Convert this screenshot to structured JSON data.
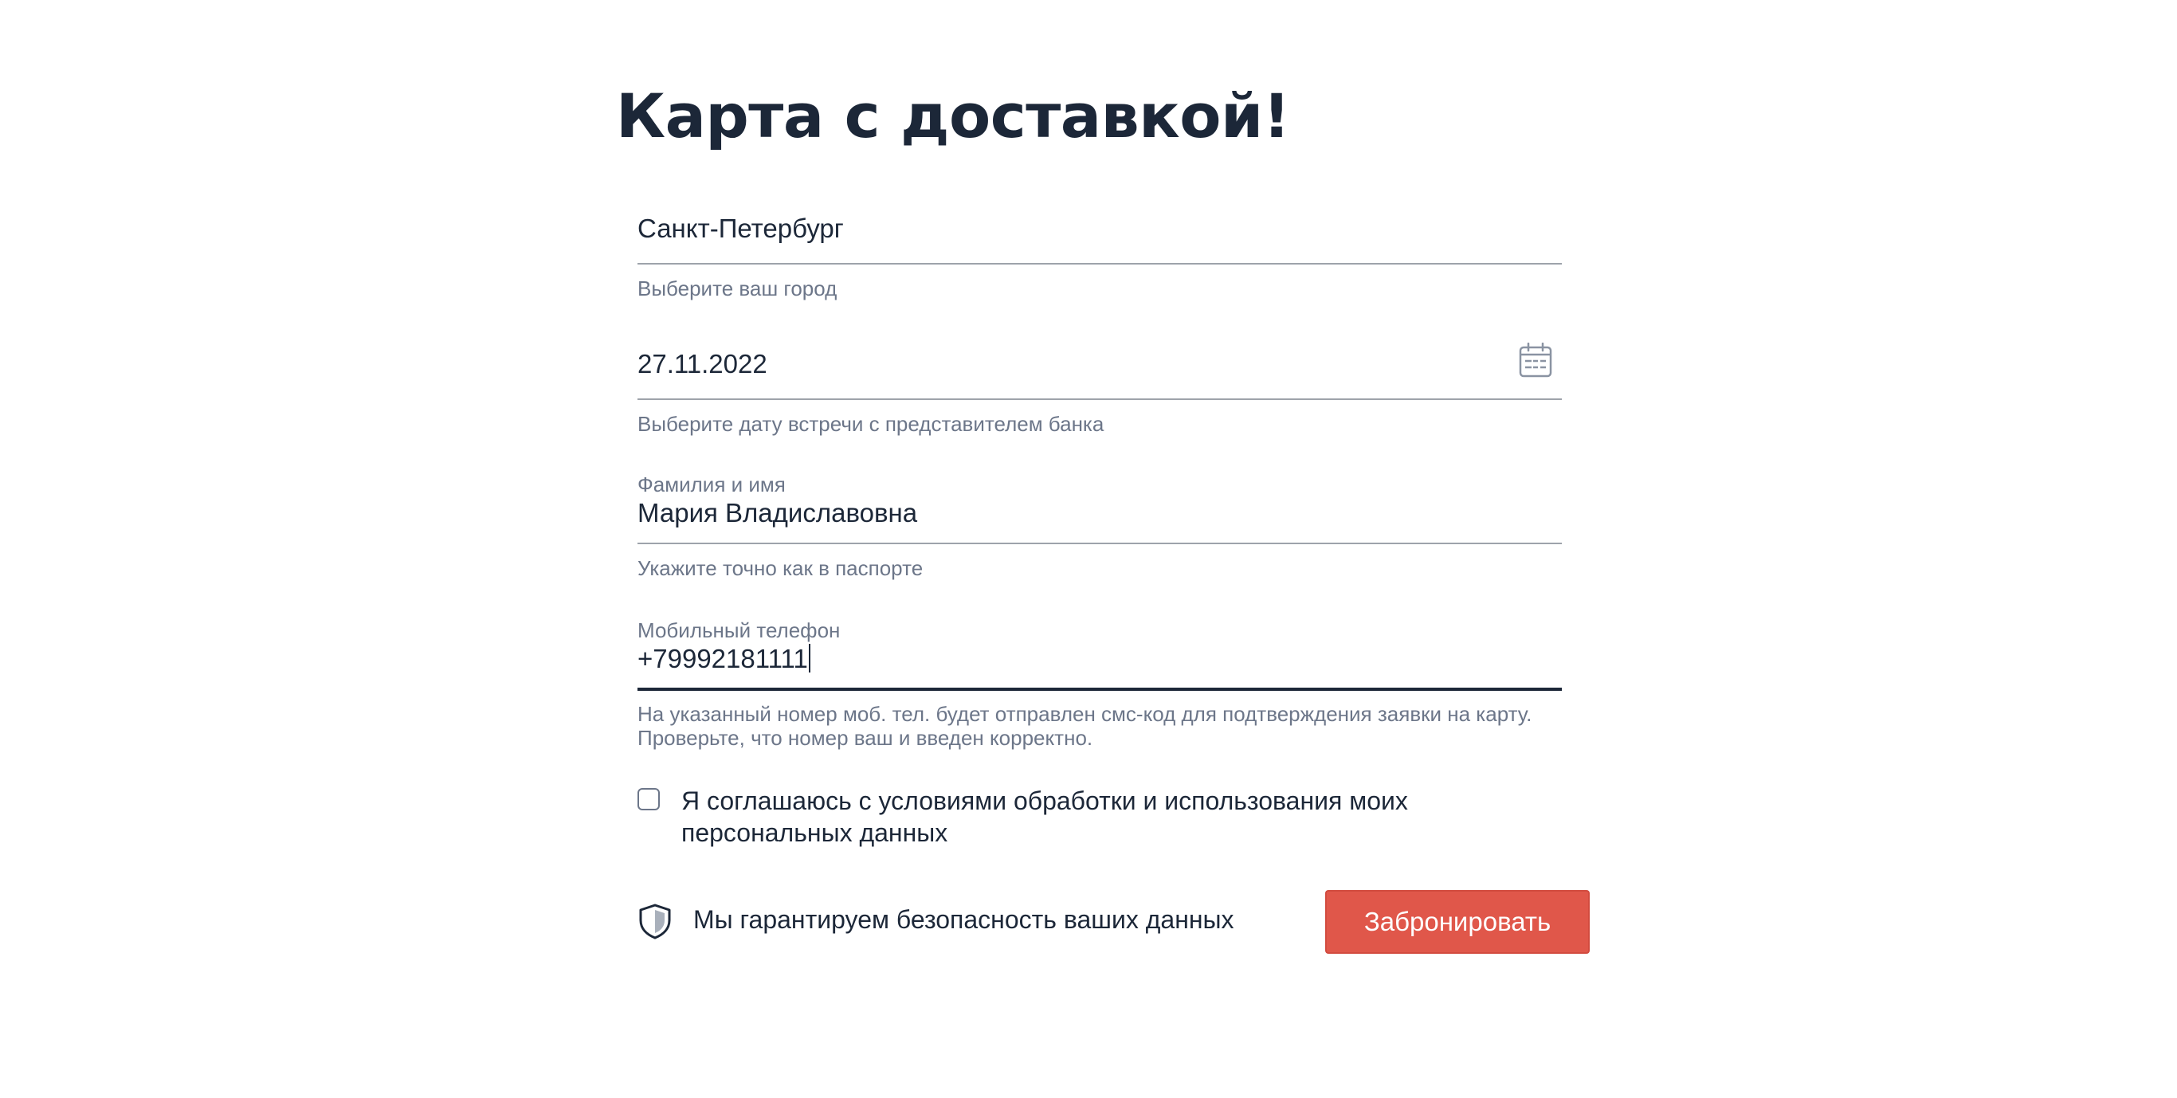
{
  "page": {
    "title": "Карта с доставкой!"
  },
  "form": {
    "city": {
      "value": "Санкт-Петербург",
      "hint": "Выберите ваш город"
    },
    "date": {
      "value": "27.11.2022",
      "hint": "Выберите дату встречи с представителем банка",
      "icon": "calendar-icon"
    },
    "full_name": {
      "label": "Фамилия и имя",
      "value": "Мария Владиславовна",
      "hint": "Укажите точно как в паспорте"
    },
    "phone": {
      "label": "Мобильный телефон",
      "value": "+79992181111",
      "hint": "На указанный номер моб. тел. будет отправлен смс-код для подтверждения заявки на карту. Проверьте, что номер ваш и введен корректно."
    },
    "consent": {
      "label": "Я соглашаюсь с условиями обработки и использования моих персональных данных",
      "checked": false
    },
    "security": {
      "text": "Мы гарантируем безопасность ваших данных",
      "icon": "shield-icon"
    },
    "submit_label": "Забронировать"
  },
  "colors": {
    "text": "#1c2738",
    "muted": "#6c7689",
    "underline": "#9ea3ab",
    "accent": "#e0574a"
  }
}
